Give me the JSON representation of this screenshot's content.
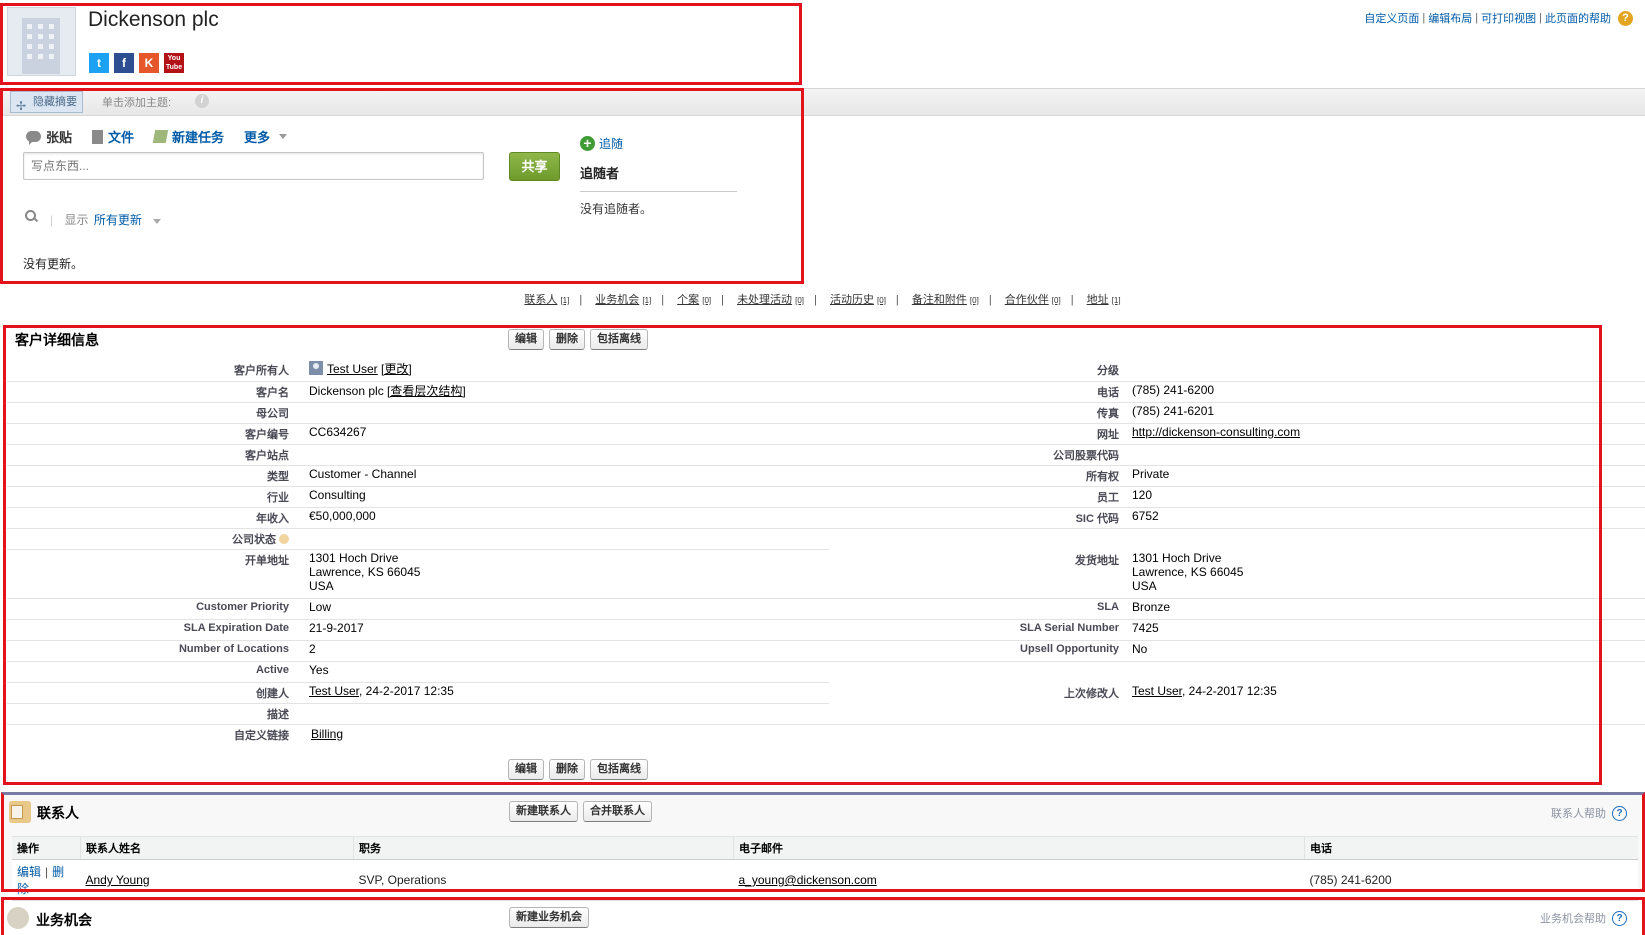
{
  "header": {
    "account_name": "Dickenson plc",
    "top_links": [
      "自定义页面",
      "编辑布局",
      "可打印视图",
      "此页面的帮助"
    ],
    "help_icon": "?",
    "socials": [
      {
        "name": "twitter",
        "glyph": "t"
      },
      {
        "name": "facebook",
        "glyph": "f"
      },
      {
        "name": "klout",
        "glyph": "K"
      },
      {
        "name": "youtube",
        "glyph": "You Tube"
      }
    ]
  },
  "feed": {
    "hide_summary": "隐藏摘要",
    "add_topic": "单击添加主题:",
    "info": "i",
    "tabs": [
      "张贴",
      "文件",
      "新建任务",
      "更多"
    ],
    "input_placeholder": "写点东西...",
    "share_label": "共享",
    "show_label": "显示",
    "filter_label": "所有更新",
    "no_updates": "没有更新。",
    "follow_label": "追随",
    "followers_title": "追随者",
    "no_followers": "没有追随者。"
  },
  "related_links": [
    {
      "label": "联系人",
      "count": "[1]"
    },
    {
      "label": "业务机会",
      "count": "[1]"
    },
    {
      "label": "个案",
      "count": "[0]"
    },
    {
      "label": "未处理活动",
      "count": "[0]"
    },
    {
      "label": "活动历史",
      "count": "[0]"
    },
    {
      "label": "备注和附件",
      "count": "[0]"
    },
    {
      "label": "合作伙伴",
      "count": "[0]"
    },
    {
      "label": "地址",
      "count": "[1]"
    }
  ],
  "detail": {
    "title": "客户详细信息",
    "buttons": [
      "编辑",
      "删除",
      "包括离线"
    ],
    "owner_label": "客户所有人",
    "owner_value": "Test User",
    "owner_change": "[更改]",
    "rating_label": "分级",
    "name_label": "客户名",
    "name_value": "Dickenson plc",
    "hierarchy_link": "[查看层次结构]",
    "phone_label": "电话",
    "phone_value": "(785) 241-6200",
    "parent_label": "母公司",
    "fax_label": "传真",
    "fax_value": "(785) 241-6201",
    "number_label": "客户编号",
    "number_value": "CC634267",
    "website_label": "网址",
    "website_value": "http://dickenson-consulting.com",
    "site_label": "客户站点",
    "ticker_label": "公司股票代码",
    "type_label": "类型",
    "type_value": "Customer - Channel",
    "ownership_label": "所有权",
    "ownership_value": "Private",
    "industry_label": "行业",
    "industry_value": "Consulting",
    "employees_label": "员工",
    "employees_value": "120",
    "revenue_label": "年收入",
    "revenue_value": "€50,000,000",
    "sic_label": "SIC 代码",
    "sic_value": "6752",
    "status_label": "公司状态",
    "billing_label": "开单地址",
    "billing_lines": [
      "1301 Hoch Drive",
      "Lawrence, KS 66045",
      "USA"
    ],
    "shipping_label": "发货地址",
    "shipping_lines": [
      "1301 Hoch Drive",
      "Lawrence, KS 66045",
      "USA"
    ],
    "priority_label": "Customer Priority",
    "priority_value": "Low",
    "sla_label": "SLA",
    "sla_value": "Bronze",
    "sla_exp_label": "SLA Expiration Date",
    "sla_exp_value": "21-9-2017",
    "sla_serial_label": "SLA Serial Number",
    "sla_serial_value": "7425",
    "locations_label": "Number of Locations",
    "locations_value": "2",
    "upsell_label": "Upsell Opportunity",
    "upsell_value": "No",
    "active_label": "Active",
    "active_value": "Yes",
    "created_label": "创建人",
    "created_user": "Test User",
    "created_date": ", 24-2-2017 12:35",
    "modified_label": "上次修改人",
    "modified_user": "Test User",
    "modified_date": ", 24-2-2017 12:35",
    "description_label": "描述",
    "custom_links_label": "自定义链接",
    "custom_link": "Billing"
  },
  "contacts": {
    "title": "联系人",
    "buttons": [
      "新建联系人",
      "合并联系人"
    ],
    "help": "联系人帮助",
    "columns": [
      "操作",
      "联系人姓名",
      "职务",
      "电子邮件",
      "电话"
    ],
    "rows": [
      {
        "edit": "编辑",
        "delete": "删除",
        "name": "Andy Young",
        "title": "SVP, Operations",
        "email": "a_young@dickenson.com",
        "phone": "(785) 241-6200"
      }
    ]
  },
  "opportunities": {
    "title": "业务机会",
    "button": "新建业务机会",
    "help": "业务机会帮助"
  }
}
